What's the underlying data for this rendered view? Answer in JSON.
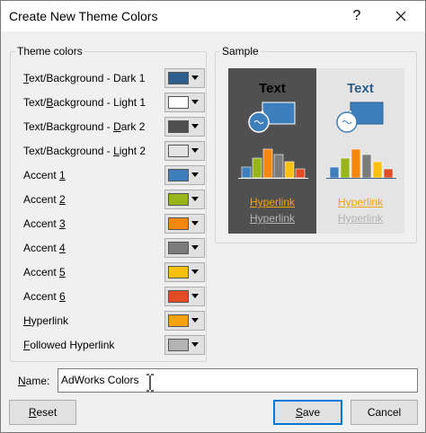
{
  "window": {
    "title": "Create New Theme Colors",
    "help_label": "?"
  },
  "theme_colors": {
    "legend": "Theme colors",
    "rows": [
      {
        "pre": "",
        "key": "T",
        "post": "ext/Background - Dark 1",
        "color": "#2f5e8c"
      },
      {
        "pre": "Text/",
        "key": "B",
        "post": "ackground - Light 1",
        "color": "#ffffff"
      },
      {
        "pre": "Text/Background - ",
        "key": "D",
        "post": "ark 2",
        "color": "#505050"
      },
      {
        "pre": "Text/Background - ",
        "key": "L",
        "post": "ight 2",
        "color": "#e4e4e4"
      },
      {
        "pre": "Accent ",
        "key": "1",
        "post": "",
        "color": "#3d7ebc"
      },
      {
        "pre": "Accent ",
        "key": "2",
        "post": "",
        "color": "#99b51c"
      },
      {
        "pre": "Accent ",
        "key": "3",
        "post": "",
        "color": "#f5870e"
      },
      {
        "pre": "Accent ",
        "key": "4",
        "post": "",
        "color": "#7b7b7b"
      },
      {
        "pre": "Accent ",
        "key": "5",
        "post": "",
        "color": "#fbc00f"
      },
      {
        "pre": "Accent ",
        "key": "6",
        "post": "",
        "color": "#e14c24"
      },
      {
        "pre": "",
        "key": "H",
        "post": "yperlink",
        "color": "#f5a20e"
      },
      {
        "pre": "",
        "key": "F",
        "post": "ollowed Hyperlink",
        "color": "#b3b3b3"
      }
    ]
  },
  "sample": {
    "legend": "Sample",
    "dark_panel": {
      "text": "Text",
      "hyperlink": "Hyperlink",
      "followed": "Hyperlink",
      "bg": "#505050",
      "text_color": "#ffffff",
      "link_color": "#f5a20e",
      "followed_color": "#b3b3b3"
    },
    "light_panel": {
      "text": "Text",
      "hyperlink": "Hyperlink",
      "followed": "Hyperlink",
      "bg": "#e4e4e4",
      "text_color": "#2f5e8c",
      "link_color": "#f5a20e",
      "followed_color": "#b3b3b3"
    },
    "bar_colors": [
      "#3d7ebc",
      "#99b51c",
      "#f5870e",
      "#7b7b7b",
      "#fbc00f",
      "#e14c24"
    ]
  },
  "name_field": {
    "label_pre": "",
    "label_key": "N",
    "label_post": "ame:",
    "value": "AdWorks Colors"
  },
  "buttons": {
    "reset": {
      "key": "R",
      "post": "eset"
    },
    "save": {
      "key": "S",
      "post": "ave"
    },
    "cancel": "Cancel"
  }
}
